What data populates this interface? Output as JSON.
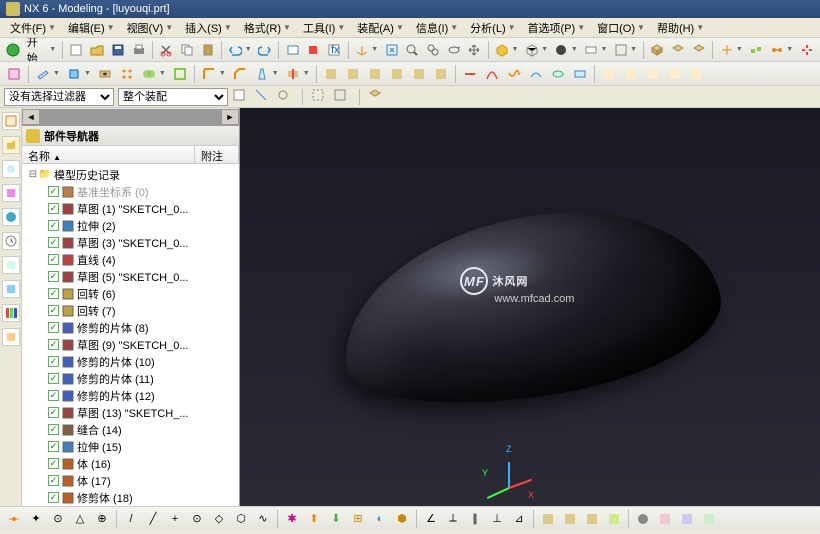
{
  "title": "NX 6 - Modeling - [luyouqi.prt]",
  "menu": [
    "文件(F)",
    "编辑(E)",
    "视图(V)",
    "插入(S)",
    "格式(R)",
    "工具(I)",
    "装配(A)",
    "信息(I)",
    "分析(L)",
    "首选项(P)",
    "窗口(O)",
    "帮助(H)"
  ],
  "start_label": "开始",
  "filter1": "没有选择过滤器",
  "filter2": "整个装配",
  "nav": {
    "title": "部件导航器",
    "col1": "名称",
    "col2": "附注",
    "root": "模型历史记录",
    "items": [
      {
        "label": "基准坐标系 (0)",
        "dim": true,
        "icon": "csys"
      },
      {
        "label": "草图 (1) \"SKETCH_0...",
        "icon": "sketch"
      },
      {
        "label": "拉伸 (2)",
        "icon": "extrude"
      },
      {
        "label": "草图 (3) \"SKETCH_0...",
        "icon": "sketch"
      },
      {
        "label": "直线 (4)",
        "icon": "line"
      },
      {
        "label": "草图 (5) \"SKETCH_0...",
        "icon": "sketch"
      },
      {
        "label": "回转 (6)",
        "icon": "revolve"
      },
      {
        "label": "回转 (7)",
        "icon": "revolve"
      },
      {
        "label": "修剪的片体 (8)",
        "icon": "trim"
      },
      {
        "label": "草图 (9) \"SKETCH_0...",
        "icon": "sketch"
      },
      {
        "label": "修剪的片体 (10)",
        "icon": "trim"
      },
      {
        "label": "修剪的片体 (11)",
        "icon": "trim"
      },
      {
        "label": "修剪的片体 (12)",
        "icon": "trim"
      },
      {
        "label": "草图 (13) \"SKETCH_...",
        "icon": "sketch"
      },
      {
        "label": "缝合 (14)",
        "icon": "sew"
      },
      {
        "label": "拉伸 (15)",
        "icon": "extrude"
      },
      {
        "label": "体 (16)",
        "icon": "body"
      },
      {
        "label": "体 (17)",
        "icon": "body"
      },
      {
        "label": "修剪体 (18)",
        "icon": "trimbody"
      }
    ]
  },
  "watermark": {
    "brand": "沐风网",
    "sub": "www.mfcad.com",
    "logo": "MF"
  },
  "triad": {
    "x": "X",
    "y": "Y",
    "z": "Z"
  },
  "iconcolors": {
    "csys": "#c08040",
    "sketch": "#a04040",
    "extrude": "#4080c0",
    "line": "#c04040",
    "revolve": "#c0a040",
    "trim": "#4060c0",
    "sew": "#806040",
    "body": "#c06020",
    "trimbody": "#c06020"
  }
}
